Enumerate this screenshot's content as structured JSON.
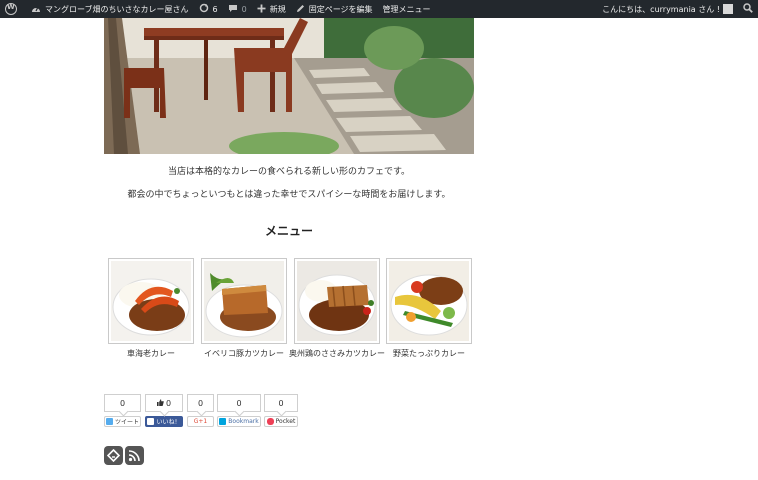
{
  "adminbar": {
    "site_name": "マングローブ畑のちいさなカレー屋さん",
    "updates_count": "6",
    "comments_count": "0",
    "new_label": "新規",
    "edit_label": "固定ページを編集",
    "admin_menu_label": "管理メニュー",
    "greeting": "こんにちは、currymania さん !"
  },
  "content": {
    "intro_line1": "当店は本格的なカレーの食べられる新しい形のカフェです。",
    "intro_line2": "都会の中でちょっといつもとは違った幸せでスパイシーな時間をお届けします。",
    "menu_heading": "メニュー",
    "menu_items": [
      {
        "label": "車海老カレー"
      },
      {
        "label": "イベリコ豚カツカレー"
      },
      {
        "label": "奥州鶏のささみカツカレー"
      },
      {
        "label": "野菜たっぷりカレー"
      }
    ]
  },
  "share": {
    "twitter": {
      "count": "0",
      "label": "ツイート"
    },
    "facebook": {
      "count": "0",
      "label": "いいね！"
    },
    "google": {
      "count": "0",
      "label": "G+1"
    },
    "hatena": {
      "count": "0",
      "label": "Bookmark"
    },
    "pocket": {
      "count": "0",
      "label": "Pocket"
    }
  },
  "colors": {
    "adminbar_bg": "#23282d",
    "facebook_blue": "#3b5998",
    "twitter_blue": "#55acee",
    "hatena_blue": "#00a4de",
    "pocket_red": "#ee4056",
    "gplus_red": "#dd4b39"
  },
  "icons": [
    "wordpress-logo-icon",
    "dashboard-icon",
    "updates-icon",
    "comments-icon",
    "plus-icon",
    "pencil-icon",
    "search-icon",
    "feedly-icon",
    "rss-icon"
  ]
}
